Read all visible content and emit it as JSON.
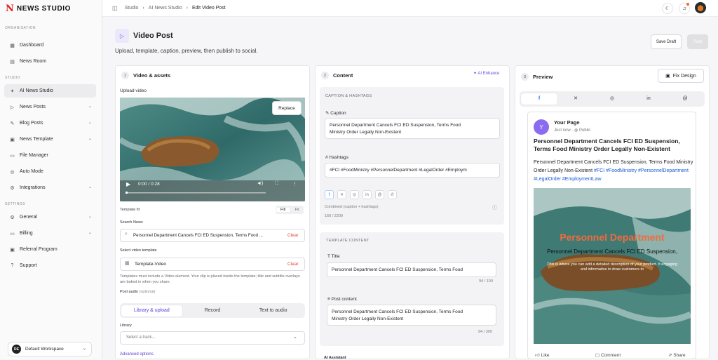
{
  "brand": {
    "mark": "N",
    "name": "NEWS STUDIO"
  },
  "sidebar": {
    "sections": [
      {
        "label": "ORGANISATION"
      },
      {
        "label": "STUDIO"
      },
      {
        "label": "SETTINGS"
      }
    ],
    "items": [
      {
        "label": "Dashboard",
        "icon": "grid-icon"
      },
      {
        "label": "News Room",
        "icon": "newspaper-icon"
      },
      {
        "label": "AI News Studio",
        "icon": "sparkle-icon"
      },
      {
        "label": "News Posts",
        "icon": "send-icon"
      },
      {
        "label": "Blog Posts",
        "icon": "pen-icon"
      },
      {
        "label": "News Template",
        "icon": "template-icon"
      },
      {
        "label": "File Manager",
        "icon": "folder-icon"
      },
      {
        "label": "Auto Mode",
        "icon": "auto-icon"
      },
      {
        "label": "Integrations",
        "icon": "plug-icon"
      },
      {
        "label": "General",
        "icon": "gear-icon"
      },
      {
        "label": "Billing",
        "icon": "card-icon"
      },
      {
        "label": "Referral Program",
        "icon": "gift-icon"
      },
      {
        "label": "Support",
        "icon": "help-icon"
      }
    ],
    "workspace": {
      "initials": "DE",
      "name": "Default Workspace"
    }
  },
  "breadcrumb": {
    "items": [
      "Studio",
      "AI News Studio",
      "Edit Video Post"
    ]
  },
  "page": {
    "title": "Video Post",
    "subtitle": "Upload, template, caption, preview, then publish to social.",
    "save_draft": "Save Draft",
    "post": "Post"
  },
  "col1": {
    "step": "1",
    "title": "Video & assets",
    "upload_label": "Upload video",
    "replace": "Replace",
    "time": "0:00 / 0:28",
    "template_fit_label": "Template fit",
    "fit_options": [
      "Fill",
      "Fit"
    ],
    "search_news_label": "Search News",
    "search_news_value": "Personnel Department Cancels FCI ED Suspension, Terms Food ...",
    "clear": "Clear",
    "select_template_label": "Select video template",
    "template_value": "Template-Video",
    "template_note": "Templates must include a Video element. Your clip is placed inside the template; title and subtitle overlays are baked in when you share.",
    "post_audio_label": "Post audio",
    "post_audio_optional": "(optional)",
    "audio_tabs": [
      "Library & upload",
      "Record",
      "Text to audio"
    ],
    "library_label": "Library",
    "library_placeholder": "Select a track...",
    "advanced": "Advanced options"
  },
  "col2": {
    "step": "2",
    "title": "Content",
    "ai_enhance": "AI Enhance",
    "caption_section": "CAPTION & HASHTAGS",
    "caption_label": "Caption",
    "caption_lines": [
      "Personnel Department Cancels FCI ED Suspension, Terms Food",
      "Ministry Order Legally Non-Existent"
    ],
    "hashtags_label": "Hashtags",
    "hashtags_value": "#FCI #FoodMinistry #PersonnelDepartment #LegalOrder #Employm",
    "combined_label": "Combined (caption + hashtags)",
    "combined_count": "160 / 2200",
    "template_section": "TEMPLATE CONTENT",
    "title_label": "Title",
    "title_value": "Personnel Department Cancels FCI ED Suspension, Terms Food",
    "title_count": "94 / 100",
    "post_content_label": "Post content",
    "post_content_lines": [
      "Personnel Department Cancels FCI ED Suspension, Terms Food",
      "Ministry Order Legally Non-Existent"
    ],
    "post_content_count": "94 / 300",
    "ai_assistant": "AI Assistant"
  },
  "col3": {
    "step": "3",
    "title": "Preview",
    "fix_design": "Fix Design",
    "platform_tabs": [
      "facebook-icon",
      "x-icon",
      "instagram-icon",
      "linkedin-icon",
      "threads-icon"
    ],
    "card": {
      "avatar": "Y",
      "page_name": "Your Page",
      "meta": "Just now",
      "visibility": "Public",
      "headline": "Personnel Department Cancels FCI ED Suspension, Terms Food Ministry Order Legally Non-Existent",
      "body": "Personnel Department Cancels FCI ED Suspension, Terms Food Ministry Order Legally Non-Existent",
      "tags": "#FCI #FoodMinistry #PersonnelDepartment #LegalOrder #EmploymentLaw",
      "overlay_title": "Personnel Department",
      "overlay_subtitle": "Personnel Department Cancels FCI ED Suspension,",
      "overlay_desc": "This is where you can add a detailed description of your product. It engaging and informative to draw customers to",
      "actions": [
        "Like",
        "Comment",
        "Share"
      ]
    }
  },
  "colors": {
    "accent": "#6a4ce0",
    "danger": "#e0452e",
    "facebook": "#1877f2"
  }
}
